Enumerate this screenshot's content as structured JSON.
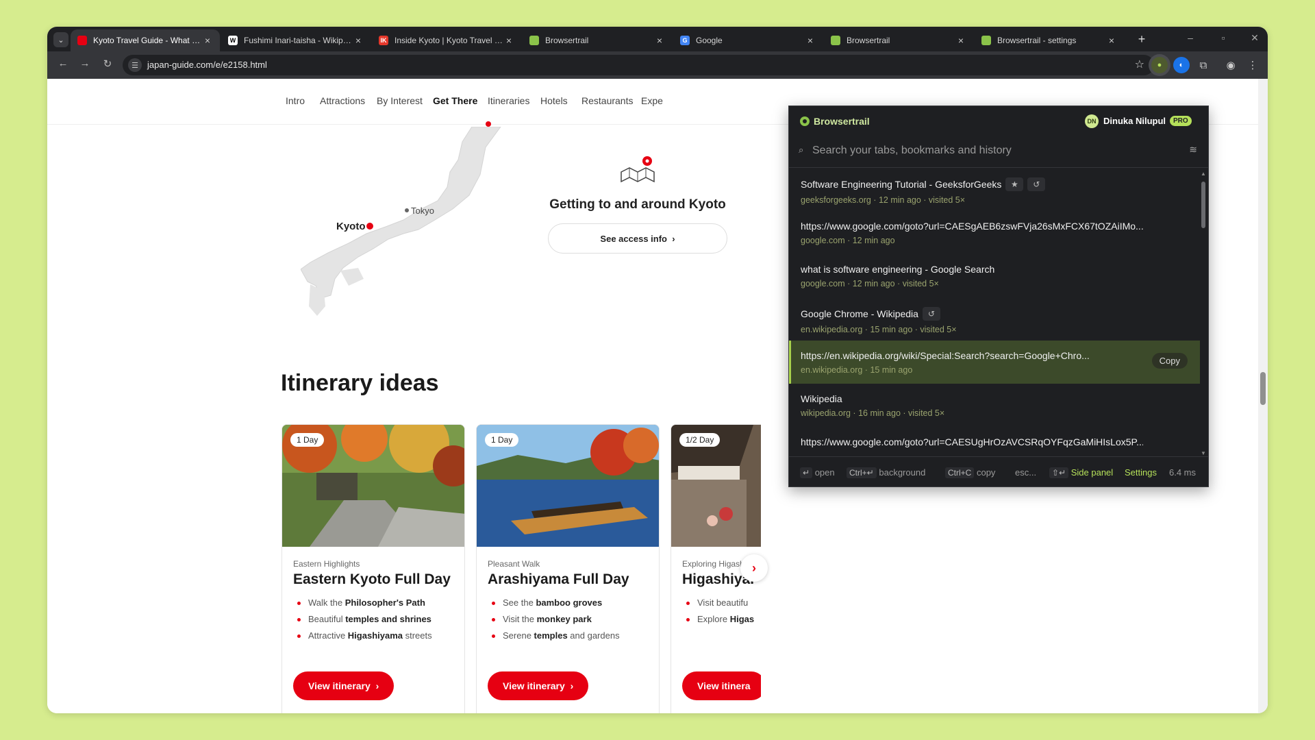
{
  "browser": {
    "tabs": [
      {
        "title": "Kyoto Travel Guide - What to do",
        "favicon_letter": "",
        "favicon_color": "#e60012",
        "active": true
      },
      {
        "title": "Fushimi Inari-taisha - Wikipedia",
        "favicon_letter": "W",
        "favicon_color": "#ffffff",
        "active": false
      },
      {
        "title": "Inside Kyoto | Kyoto Travel Guide",
        "favicon_letter": "IK",
        "favicon_color": "#e5382b",
        "active": false
      },
      {
        "title": "Browsertrail",
        "favicon_letter": "",
        "favicon_color": "#8bc34a",
        "active": false
      },
      {
        "title": "Google",
        "favicon_letter": "G",
        "favicon_color": "#4285f4",
        "active": false
      },
      {
        "title": "Browsertrail",
        "favicon_letter": "",
        "favicon_color": "#8bc34a",
        "active": false
      },
      {
        "title": "Browsertrail - settings",
        "favicon_letter": "",
        "favicon_color": "#8bc34a",
        "active": false
      }
    ],
    "new_tab_icon": "+",
    "url": "japan-guide.com/e/e2158.html"
  },
  "site": {
    "nav": [
      "Intro",
      "Attractions",
      "By Interest",
      "Get There",
      "Itineraries",
      "Hotels",
      "Restaurants",
      "Expe"
    ],
    "active_nav": "Get There",
    "map": {
      "kyoto_label": "Kyoto",
      "tokyo_label": "Tokyo"
    },
    "access": {
      "title": "Getting to and around Kyoto",
      "button": "See access info"
    },
    "itinerary_title": "Itinerary ideas",
    "cards": [
      {
        "badge": "1 Day",
        "subtitle": "Eastern Highlights",
        "title": "Eastern Kyoto Full Day",
        "items": [
          {
            "pre": "Walk the ",
            "bold": "Philosopher's Path",
            "post": ""
          },
          {
            "pre": "Beautiful ",
            "bold": "temples and shrines",
            "post": ""
          },
          {
            "pre": "Attractive ",
            "bold": "Higashiyama",
            "post": " streets"
          }
        ],
        "button": "View itinerary"
      },
      {
        "badge": "1 Day",
        "subtitle": "Pleasant Walk",
        "title": "Arashiyama Full Day",
        "items": [
          {
            "pre": "See the ",
            "bold": "bamboo groves",
            "post": ""
          },
          {
            "pre": "Visit the ",
            "bold": "monkey park",
            "post": ""
          },
          {
            "pre": "Serene ",
            "bold": "temples",
            "post": " and gardens"
          }
        ],
        "button": "View itinerary"
      },
      {
        "badge": "1/2 Day",
        "subtitle": "Exploring Higashi",
        "title": "Higashiyar",
        "items": [
          {
            "pre": "Visit beautifu",
            "bold": "",
            "post": ""
          },
          {
            "pre": "Explore ",
            "bold": "Higas",
            "post": ""
          }
        ],
        "button": "View itinera"
      }
    ]
  },
  "popup": {
    "app_name": "Browsertrail",
    "user_initials": "DN",
    "user_name": "Dinuka Nilupul",
    "plan_badge": "PRO",
    "search_placeholder": "Search your tabs, bookmarks and history",
    "results": [
      {
        "title": "Software Engineering Tutorial - GeeksforGeeks",
        "meta": "geeksforgeeks.org · 12 min ago · visited 5×",
        "chips": [
          "star-icon",
          "history-icon"
        ],
        "selected": false
      },
      {
        "title": "https://www.google.com/goto?url=CAESgAEB6zswFVja26sMxFCX67tOZAiIMo...",
        "meta": "google.com · 12 min ago",
        "chips": [],
        "selected": false
      },
      {
        "title": "what is software engineering - Google Search",
        "meta": "google.com · 12 min ago · visited 5×",
        "chips": [],
        "selected": false
      },
      {
        "title": "Google Chrome - Wikipedia",
        "meta": "en.wikipedia.org · 15 min ago · visited 5×",
        "chips": [
          "history-icon"
        ],
        "selected": false
      },
      {
        "title": "https://en.wikipedia.org/wiki/Special:Search?search=Google+Chro...",
        "meta": "en.wikipedia.org · 15 min ago",
        "chips": [],
        "selected": true
      },
      {
        "title": "Wikipedia",
        "meta": "wikipedia.org · 16 min ago · visited 5×",
        "chips": [],
        "selected": false
      },
      {
        "title": "https://www.google.com/goto?url=CAESUgHrOzAVCSRqOYFqzGaMiHIsLox5P...",
        "meta": "",
        "chips": [],
        "selected": false
      }
    ],
    "copy_label": "Copy",
    "footer": {
      "open_key": "↵",
      "open_label": "open",
      "bg_key": "Ctrl+↵",
      "bg_label": "background",
      "copy_key": "Ctrl+C",
      "copy_label": "copy",
      "esc_label": "esc...",
      "side_key": "⇧↵",
      "side_panel": "Side panel",
      "settings": "Settings",
      "timing": "6.4 ms"
    }
  },
  "colors": {
    "accent_red": "#e60012",
    "popup_bg": "#1e1f22",
    "popup_accent": "#b5e05a",
    "backdrop": "#d6ec8e"
  }
}
